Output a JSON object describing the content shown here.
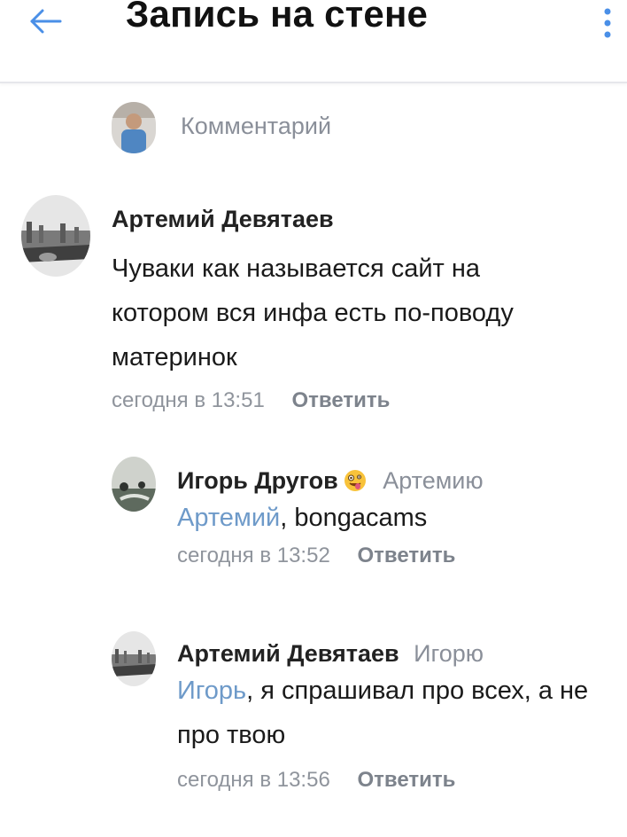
{
  "header": {
    "title": "Запись на стене",
    "back_icon": "arrow-left-icon",
    "menu_icon": "more-vertical-icon"
  },
  "comment_input": {
    "placeholder": "Комментарий"
  },
  "comments": [
    {
      "author": "Артемий Девятаев",
      "text_lines": [
        "Чуваки как называется сайт на",
        "котором вся инфа есть по-поводу",
        "материнок"
      ],
      "time": "сегодня в 13:51",
      "reply_label": "Ответить"
    },
    {
      "author": "Игорь Другов",
      "emoji": "crazy-face-emoji",
      "reply_to": "Артемию",
      "mention": "Артемий",
      "text": ", bongacams",
      "time": "сегодня в 13:52",
      "reply_label": "Ответить"
    },
    {
      "author": "Артемий Девятаев",
      "reply_to": "Игорю",
      "mention": "Игорь",
      "text_line1": ", я спрашивал про всех, а не",
      "text_line2": "про твою",
      "time": "сегодня в 13:56",
      "reply_label": "Ответить"
    }
  ],
  "colors": {
    "accent": "#4a8fe7",
    "mention": "#6e9ac9",
    "meta": "#8f949c"
  }
}
